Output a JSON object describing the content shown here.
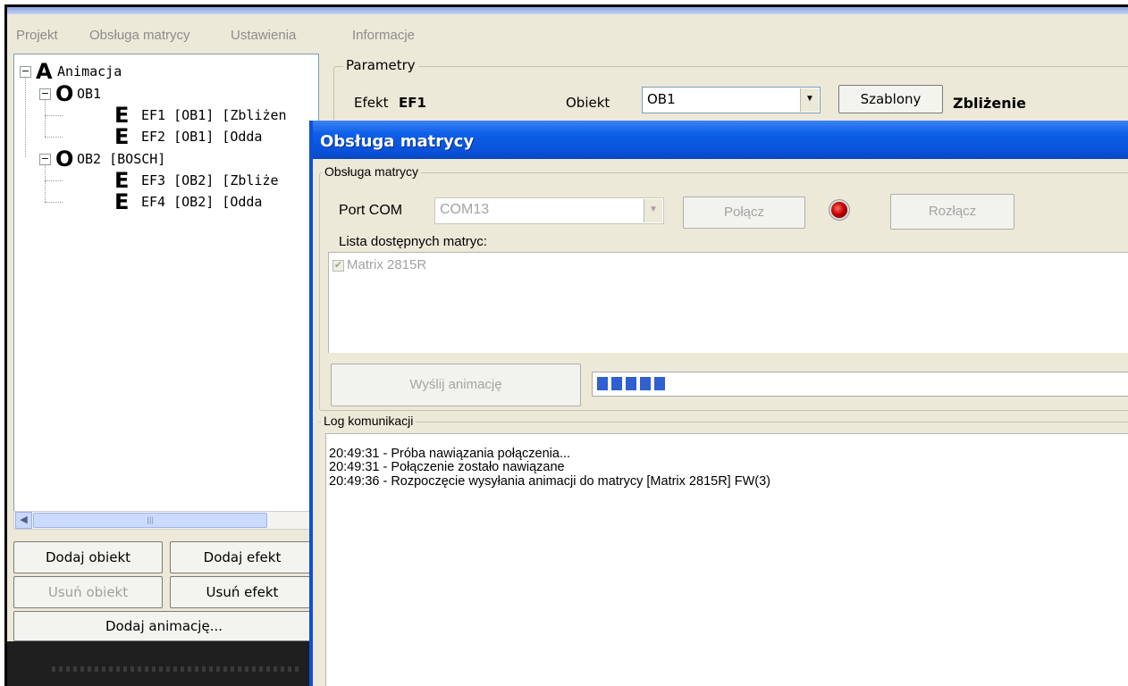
{
  "menu": {
    "items": [
      "Projekt",
      "Obsługa matrycy",
      "Ustawienia",
      "Informacje"
    ]
  },
  "tree": {
    "root": {
      "glyph": "A",
      "label": "Animacja",
      "expander": "−"
    },
    "ob1": {
      "glyph": "O",
      "label": "OB1",
      "expander": "−"
    },
    "ef1": {
      "glyph": "E",
      "label": "EF1 [OB1] [Zbliżen"
    },
    "ef2": {
      "glyph": "E",
      "label": "EF2 [OB1] [Odda"
    },
    "ob2": {
      "glyph": "O",
      "label": "OB2 [BOSCH]",
      "expander": "−"
    },
    "ef3": {
      "glyph": "E",
      "label": "EF3 [OB2] [Zbliże"
    },
    "ef4": {
      "glyph": "E",
      "label": "EF4 [OB2] [Odda"
    }
  },
  "scroll": {
    "left_arrow": "◀",
    "grip": "|||"
  },
  "buttons": {
    "add_object": "Dodaj obiekt",
    "add_effect": "Dodaj efekt",
    "remove_object": "Usuń obiekt",
    "remove_effect": "Usuń efekt",
    "add_animation": "Dodaj animację..."
  },
  "params": {
    "group_title": "Parametry",
    "effect_label": "Efekt",
    "effect_value": "EF1",
    "object_label": "Obiekt",
    "object_value": "OB1",
    "templates_button": "Szablony",
    "template_name": "Zbliżenie"
  },
  "dialog": {
    "title": "Obsługa matrycy",
    "group_title": "Obsługa matrycy",
    "port_label": "Port COM",
    "port_value": "COM13",
    "connect_button": "Połącz",
    "disconnect_button": "Rozłącz",
    "list_label": "Lista dostępnych matryc:",
    "matrix_item": "Matrix 2815R",
    "matrix_checked": true,
    "send_button": "Wyślij animację",
    "progress_segments": 5,
    "log_title": "Log komunikacji",
    "log": [
      "20:49:31 - Próba nawiązania połączenia...",
      "20:49:31 - Połączenie zostało nawiązane",
      "20:49:36 - Rozpoczęcie wysyłania animacji do matrycy [Matrix 2815R] FW(3)"
    ]
  },
  "colors": {
    "titlebar": "#0a52d8",
    "progress": "#2f5fd0",
    "led": "#c40000",
    "window_bg": "#ece9d8"
  }
}
